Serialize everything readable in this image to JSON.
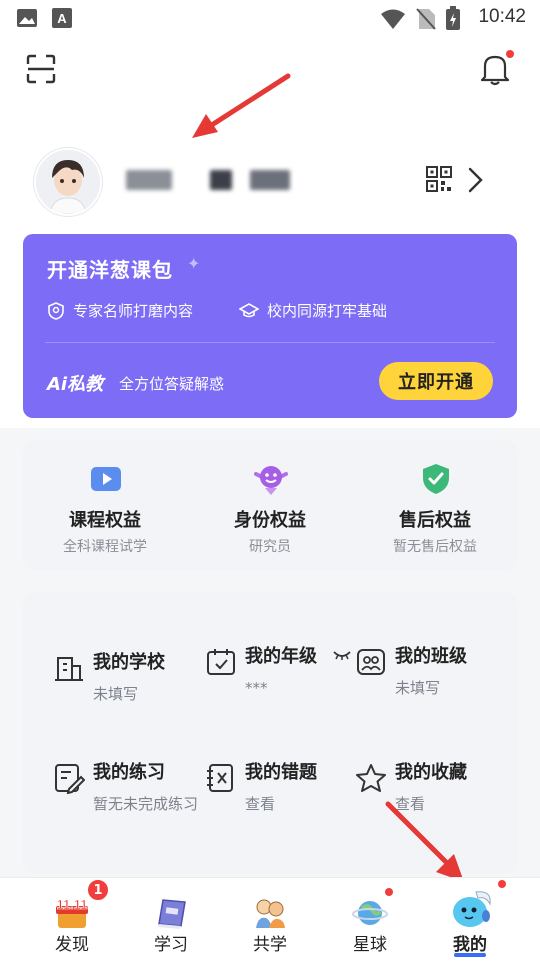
{
  "status_bar": {
    "time": "10:42"
  },
  "card": {
    "title": "开通洋葱课包",
    "features": [
      "专家名师打磨内容",
      "校内同源打牢基础"
    ],
    "ai_logo": "Ai私教",
    "ai_subtitle": "全方位答疑解惑",
    "open_button": "立即开通",
    "bg_color": "#7d6cf5",
    "button_color": "#ffd43b"
  },
  "benefits": [
    {
      "title": "课程权益",
      "subtitle": "全科课程试学",
      "icon": "play-icon"
    },
    {
      "title": "身份权益",
      "subtitle": "研究员",
      "icon": "identity-badge-icon"
    },
    {
      "title": "售后权益",
      "subtitle": "暂无售后权益",
      "icon": "shield-check-icon"
    }
  ],
  "profile": [
    {
      "title": "我的学校",
      "value": "未填写",
      "icon": "school-icon"
    },
    {
      "title": "我的年级",
      "value": "***",
      "icon": "calendar-icon"
    },
    {
      "title": "我的班级",
      "value": "未填写",
      "icon": "class-icon"
    },
    {
      "title": "我的练习",
      "value": "暂无未完成练习",
      "icon": "edit-icon"
    },
    {
      "title": "我的错题",
      "value": "查看",
      "icon": "wrong-book-icon"
    },
    {
      "title": "我的收藏",
      "value": "查看",
      "icon": "star-icon"
    }
  ],
  "nav": {
    "items": [
      {
        "label": "发现",
        "icon": "discover-1111-icon"
      },
      {
        "label": "学习",
        "icon": "book-icon"
      },
      {
        "label": "共学",
        "icon": "together-icon"
      },
      {
        "label": "星球",
        "icon": "planet-icon"
      },
      {
        "label": "我的",
        "icon": "mascot-icon"
      }
    ],
    "discover_badge": "1",
    "active_color": "#3b6cf6"
  }
}
